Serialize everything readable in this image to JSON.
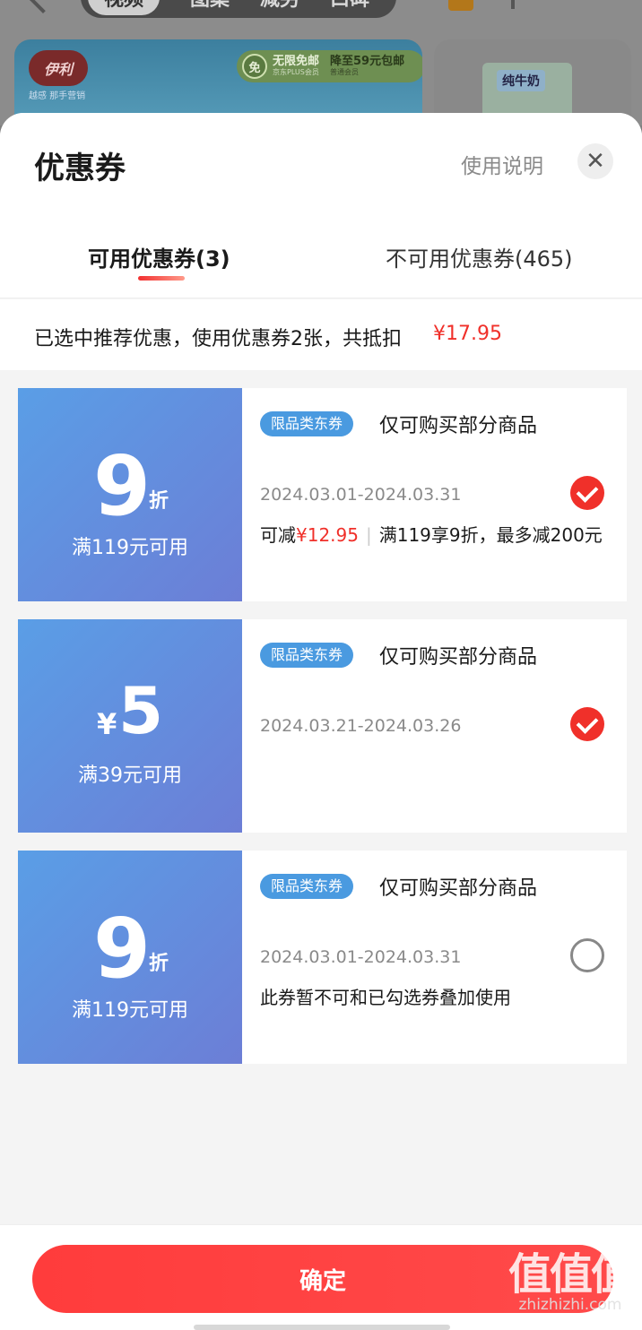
{
  "background": {
    "tabs": [
      "视频",
      "图集",
      "减另",
      "口碑"
    ],
    "brand_logo": "伊利",
    "brand_tagline": "越感 那手营销",
    "promo": {
      "badge": "免",
      "title": "无限免邮",
      "sub": "京东PLUS会员",
      "right_title": "降至59元包邮",
      "right_sub": "普通会员"
    },
    "product_label": "纯牛奶"
  },
  "sheet": {
    "title": "优惠券",
    "help_label": "使用说明",
    "close_icon": "close-icon",
    "tabs": [
      {
        "label": "可用优惠券(3)",
        "active": true
      },
      {
        "label": "不可用优惠券(465)",
        "active": false
      }
    ],
    "summary": {
      "text": "已选中推荐优惠，使用优惠券2张，共抵扣",
      "amount": "¥17.95"
    },
    "coupons": [
      {
        "big": "9",
        "unit": "折",
        "condition": "满119元可用",
        "badge": "限品类东券",
        "title": "仅可购买部分商品",
        "date": "2024.03.01-2024.03.31",
        "note_prefix": "可减",
        "note_amount": "¥12.95",
        "note_sep": "|",
        "note_rest": "满119享9折，最多减200元",
        "checked": true
      },
      {
        "big": "5",
        "unit": "¥",
        "condition": "满39元可用",
        "badge": "限品类东券",
        "title": "仅可购买部分商品",
        "date": "2024.03.21-2024.03.26",
        "checked": true
      },
      {
        "big": "9",
        "unit": "折",
        "condition": "满119元可用",
        "badge": "限品类东券",
        "title": "仅可购买部分商品",
        "date": "2024.03.01-2024.03.31",
        "note": "此券暂不可和已勾选券叠加使用",
        "checked": false
      }
    ],
    "confirm_label": "确定"
  },
  "watermark": {
    "logo": "值值值",
    "url": "zhizhizhi.com"
  },
  "colors": {
    "accent_red": "#f0302a",
    "coupon_blue_start": "#5a9ee6",
    "coupon_blue_end": "#6c7ed6",
    "badge_blue": "#4a9ae0"
  }
}
